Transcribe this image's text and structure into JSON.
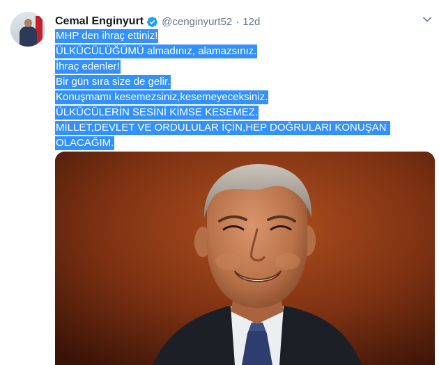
{
  "tweet": {
    "author_name": "Cemal Enginyurt",
    "handle": "@cenginyurt52",
    "separator": "·",
    "timestamp": "12d",
    "lines": [
      "MHP den ihraç ettiniz!",
      "ÜLKÜCÜLÜĞÜMÜ almadınız, alamazsınız.",
      "İhraç edenler!",
      "Bir gün sıra size de gelir.",
      "Konuşmamı kesemezsiniz,kesemeyeceksiniz.",
      "ÜLKÜCÜLERİN SESİNİ KİMSE KESEMEZ.",
      "MİLLET,DEVLET VE ORDULULAR İÇİN,HEP DOĞRULARI KONUŞAN ",
      "OLACAĞIM."
    ]
  },
  "icons": {
    "verified": "verified-badge-icon",
    "caret": "chevron-down-icon"
  },
  "colors": {
    "selection": "#3390ff",
    "verified": "#1da1f2",
    "secondary_text": "#657786",
    "photo_background": "#7a2e13"
  }
}
